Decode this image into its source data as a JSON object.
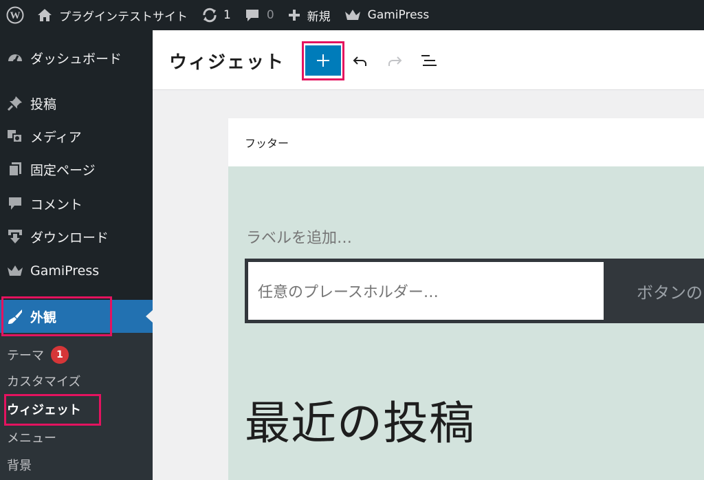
{
  "adminbar": {
    "site_name": "プラグインテストサイト",
    "updates_count": "1",
    "comments_count": "0",
    "new_label": "新規",
    "gamipress_label": "GamiPress"
  },
  "sidebar": {
    "items": [
      {
        "label": "ダッシュボード",
        "icon": "dashboard-icon"
      },
      {
        "label": "投稿",
        "icon": "pin-icon"
      },
      {
        "label": "メディア",
        "icon": "media-icon"
      },
      {
        "label": "固定ページ",
        "icon": "pages-icon"
      },
      {
        "label": "コメント",
        "icon": "comment-icon"
      },
      {
        "label": "ダウンロード",
        "icon": "download-icon"
      },
      {
        "label": "GamiPress",
        "icon": "crown-icon"
      },
      {
        "label": "外観",
        "icon": "paintbrush-icon"
      }
    ],
    "submenu": [
      {
        "label": "テーマ",
        "badge": "1"
      },
      {
        "label": "カスタマイズ"
      },
      {
        "label": "ウィジェット"
      },
      {
        "label": "メニュー"
      },
      {
        "label": "背景"
      }
    ]
  },
  "editor": {
    "title": "ウィジェット"
  },
  "widget_area": {
    "name": "フッター",
    "search_label": "ラベルを追加…",
    "search_placeholder": "任意のプレースホルダー…",
    "search_button": "ボタンの",
    "recent_posts_heading": "最近の投稿"
  },
  "colors": {
    "admin_dark": "#1d2327",
    "admin_blue": "#2271b1",
    "editor_blue": "#007cba",
    "highlight": "#e4135f",
    "widget_bg": "#d3e3dd"
  }
}
